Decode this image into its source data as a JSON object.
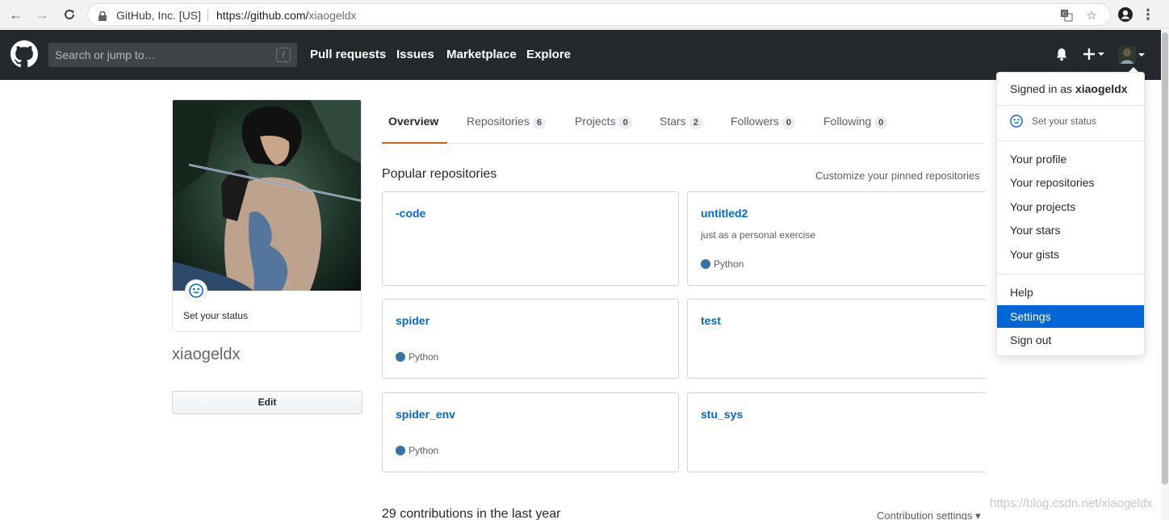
{
  "browser": {
    "site_identity": "GitHub, Inc. [US]",
    "url_host": "https://github.com/",
    "url_path": "xiaogeldx"
  },
  "header": {
    "search_placeholder": "Search or jump to…",
    "search_shortcut": "/",
    "nav": [
      "Pull requests",
      "Issues",
      "Marketplace",
      "Explore"
    ]
  },
  "profile": {
    "status_text": "Set your status",
    "username": "xiaogeldx",
    "edit_label": "Edit"
  },
  "tabs": [
    {
      "label": "Overview",
      "count": null,
      "selected": true
    },
    {
      "label": "Repositories",
      "count": "6"
    },
    {
      "label": "Projects",
      "count": "0"
    },
    {
      "label": "Stars",
      "count": "2"
    },
    {
      "label": "Followers",
      "count": "0"
    },
    {
      "label": "Following",
      "count": "0"
    }
  ],
  "repos_section": {
    "title": "Popular repositories",
    "customize": "Customize your pinned repositories"
  },
  "repos": [
    {
      "name": "-code",
      "description": "",
      "language": ""
    },
    {
      "name": "untitled2",
      "description": "just as a personal exercise",
      "language": "Python"
    },
    {
      "name": "spider",
      "description": "",
      "language": "Python"
    },
    {
      "name": "test",
      "description": "",
      "language": ""
    },
    {
      "name": "spider_env",
      "description": "",
      "language": "Python"
    },
    {
      "name": "stu_sys",
      "description": "",
      "language": ""
    }
  ],
  "contributions": {
    "title": "29 contributions in the last year",
    "settings": "Contribution settings ▾"
  },
  "dropdown": {
    "signed_in_prefix": "Signed in as",
    "signed_in_user": "xiaogeldx",
    "set_status": "Set your status",
    "group1": [
      "Your profile",
      "Your repositories",
      "Your projects",
      "Your stars",
      "Your gists"
    ],
    "group2": [
      "Help",
      "Settings",
      "Sign out"
    ],
    "active_item": "Settings"
  },
  "colors": {
    "header_bg": "#24292e",
    "link_blue": "#0366d6",
    "python_dot": "#3572A5",
    "tab_accent": "#e36209"
  },
  "watermark": "https://blog.csdn.net/xiaogeldx"
}
